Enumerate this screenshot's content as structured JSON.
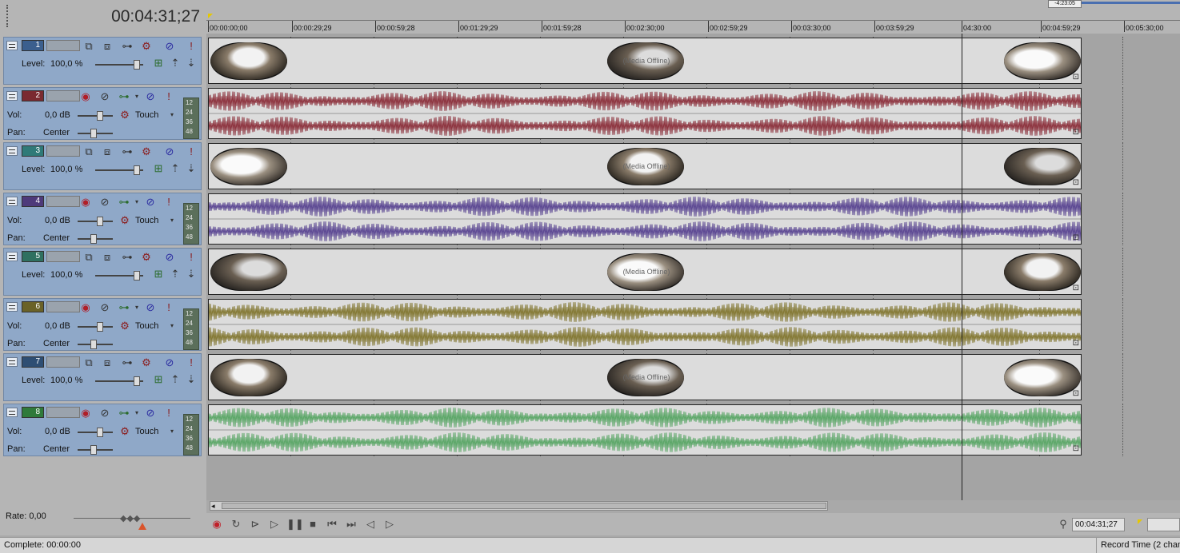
{
  "app": {
    "current_time": "00:04:31;27",
    "corner_time": "-4:23:05"
  },
  "ruler": {
    "ticks": [
      "00:00:00;00",
      "00:00:29;29",
      "00:00:59;28",
      "00:01:29;29",
      "00:01:59;28",
      "00:02:30;00",
      "00:02:59;29",
      "00:03:30;00",
      "00:03:59;29",
      "04:30:00",
      "00:04:59;29",
      "00:05:30;00"
    ]
  },
  "tracks": [
    {
      "num": "1",
      "kind": "video",
      "color": "#3b5f8e",
      "level_label": "Level:",
      "level_value": "100,0 %"
    },
    {
      "num": "2",
      "kind": "audio",
      "color": "#7a2a30",
      "wave": "#8e3540",
      "vol_label": "Vol:",
      "vol_value": "0,0 dB",
      "pan_label": "Pan:",
      "pan_value": "Center",
      "mode": "Touch"
    },
    {
      "num": "3",
      "kind": "video",
      "color": "#2f7a78",
      "level_label": "Level:",
      "level_value": "100,0 %"
    },
    {
      "num": "4",
      "kind": "audio",
      "color": "#4e3a7a",
      "wave": "#5e4a94",
      "vol_label": "Vol:",
      "vol_value": "0,0 dB",
      "pan_label": "Pan:",
      "pan_value": "Center",
      "mode": "Touch"
    },
    {
      "num": "5",
      "kind": "video",
      "color": "#2f7060",
      "level_label": "Level:",
      "level_value": "100,0 %"
    },
    {
      "num": "6",
      "kind": "audio",
      "color": "#6a6228",
      "wave": "#857a36",
      "vol_label": "Vol:",
      "vol_value": "0,0 dB",
      "pan_label": "Pan:",
      "pan_value": "Center",
      "mode": "Touch"
    },
    {
      "num": "7",
      "kind": "video",
      "color": "#2e4e73",
      "level_label": "Level:",
      "level_value": "100,0 %"
    },
    {
      "num": "8",
      "kind": "audio",
      "color": "#2f7a3a",
      "wave": "#5ea86a",
      "vol_label": "Vol:",
      "vol_value": "0,0 dB",
      "pan_label": "Pan:",
      "pan_value": "Center",
      "mode": "Touch"
    }
  ],
  "meter_labels": [
    "12",
    "24",
    "36",
    "48"
  ],
  "offline_text": "(Media Offline)",
  "rate": {
    "label": "Rate: 0,00"
  },
  "transport": {
    "time": "00:04:31;27"
  },
  "status": {
    "complete": "Complete: 00:00:00",
    "record_time": "Record Time (2 chan"
  }
}
